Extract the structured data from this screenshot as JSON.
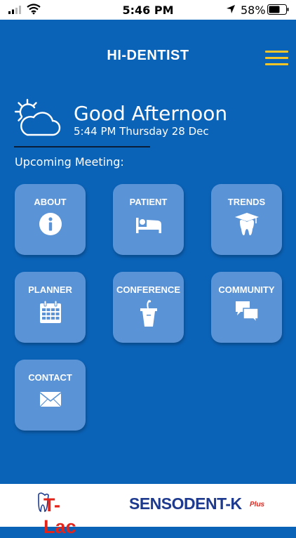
{
  "status_bar": {
    "time": "5:46 PM",
    "battery": "58%"
  },
  "header": {
    "title": "HI-DENTIST"
  },
  "greeting": {
    "text": "Good Afternoon",
    "datetime": "5:44 PM Thursday 28 Dec"
  },
  "upcoming_label": "Upcoming Meeting:",
  "tiles": [
    {
      "label": "ABOUT",
      "icon": "info-icon"
    },
    {
      "label": "PATIENT",
      "icon": "bed-icon"
    },
    {
      "label": "TRENDS",
      "icon": "tooth-graduation-icon"
    },
    {
      "label": "PLANNER",
      "icon": "calendar-icon"
    },
    {
      "label": "CONFERENCE",
      "icon": "podium-icon"
    },
    {
      "label": "COMMUNITY",
      "icon": "chat-bubbles-icon"
    },
    {
      "label": "CONTACT",
      "icon": "envelope-icon"
    }
  ],
  "footer": {
    "logo1": "T-Lac",
    "logo2": "SENSODENT-K",
    "logo2_suffix": "Plus"
  },
  "colors": {
    "background": "#0b63b8",
    "tile": "#5a93d6",
    "menu_accent": "#f5c528"
  }
}
